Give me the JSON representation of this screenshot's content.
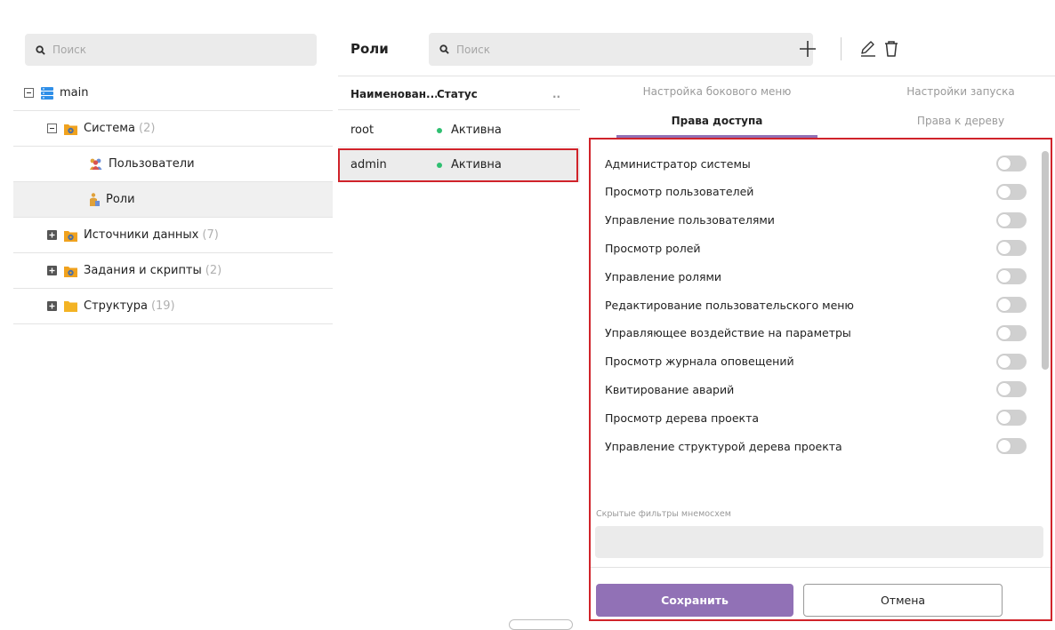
{
  "tree": {
    "search_placeholder": "Поиск",
    "root": {
      "label": "main"
    },
    "items": [
      {
        "label": "Система",
        "count": "(2)"
      },
      {
        "label": "Пользователи"
      },
      {
        "label": "Роли"
      },
      {
        "label": "Источники данных",
        "count": "(7)"
      },
      {
        "label": "Задания и скрипты",
        "count": "(2)"
      },
      {
        "label": "Структура",
        "count": "(19)"
      }
    ]
  },
  "roles": {
    "title": "Роли",
    "search_placeholder": "Поиск",
    "columns": {
      "name": "Наименован...",
      "status": "Статус",
      "more": ".."
    },
    "rows": [
      {
        "name": "root",
        "status": "Активна"
      },
      {
        "name": "admin",
        "status": "Активна"
      }
    ],
    "toolbar": {
      "add_icon": "plus-icon",
      "edit_icon": "pencil-icon",
      "delete_icon": "trash-icon"
    }
  },
  "settings": {
    "tabs": [
      "Настройка бокового меню",
      "Настройки запуска",
      "Права доступа",
      "Права к дереву"
    ],
    "permissions": [
      "Администратор системы",
      "Просмотр пользователей",
      "Управление пользователями",
      "Просмотр ролей",
      "Управление ролями",
      "Редактирование пользовательского меню",
      "Управляющее воздействие на параметры",
      "Просмотр журнала оповещений",
      "Квитирование аварий",
      "Просмотр дерева проекта",
      "Управление структурой дерева проекта"
    ],
    "filters_label": "Скрытые фильтры мнемосхем",
    "save_label": "Сохранить",
    "cancel_label": "Отмена"
  },
  "colors": {
    "accent": "#9171b6",
    "status_active": "#2fbf71",
    "highlight_outline": "#d0232a",
    "folder_orange": "#f0a21e",
    "db_blue": "#2f8fe8"
  }
}
